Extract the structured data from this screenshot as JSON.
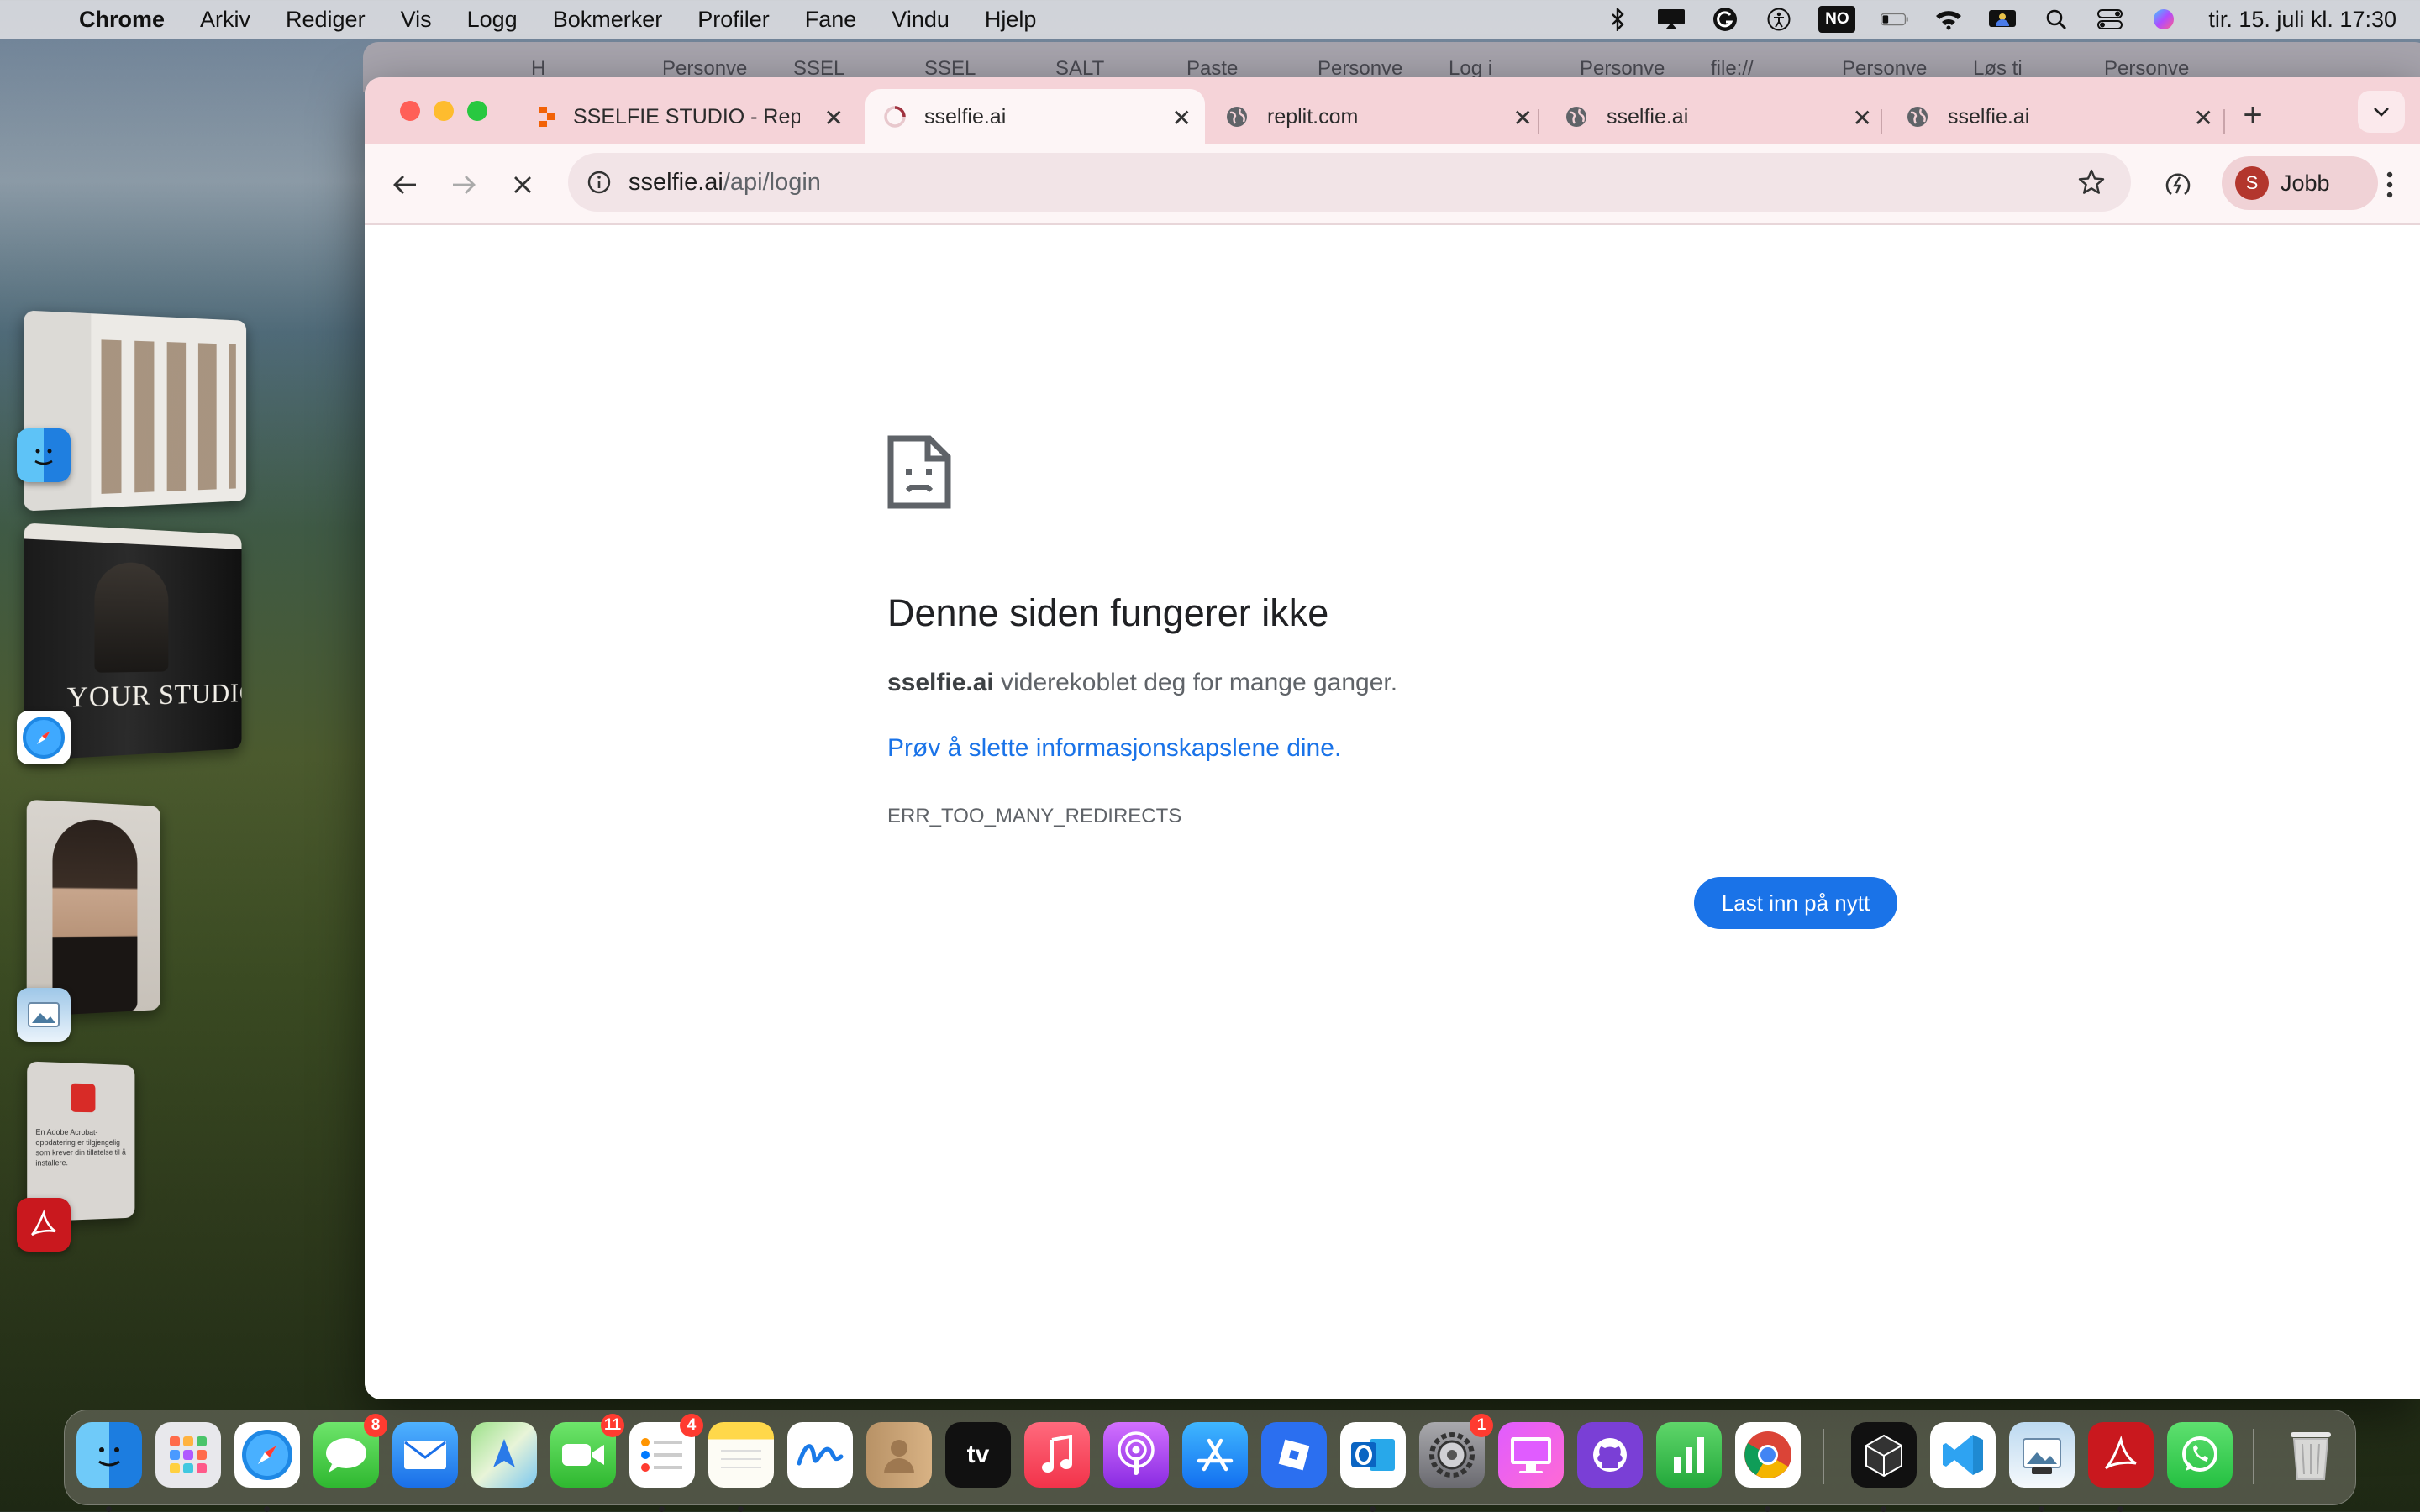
{
  "menubar": {
    "app_name": "Chrome",
    "items": [
      "Arkiv",
      "Rediger",
      "Vis",
      "Logg",
      "Bokmerker",
      "Profiler",
      "Fane",
      "Vindu",
      "Hjelp"
    ],
    "input_source": "NO",
    "datetime": "tir. 15. juli kl. 17:30"
  },
  "desktop": {
    "studio_thumb_text": "YOUR STUDIO",
    "acrobat_card_text": "En Adobe Acrobat-oppdatering er tilgjengelig som krever din tillatelse til å installere."
  },
  "back_window": {
    "tabs": [
      "H",
      "Personve",
      "SSEL",
      "SSEL",
      "SALT",
      "Paste",
      "Personve",
      "Log i",
      "Personve",
      "file://",
      "Personve",
      "Løs ti",
      "Personve"
    ]
  },
  "tabs": [
    {
      "title": "SSELFIE STUDIO - Repl",
      "icon": "replit-icon",
      "active": false
    },
    {
      "title": "sselfie.ai",
      "icon": "loading-spinner-icon",
      "active": true
    },
    {
      "title": "replit.com",
      "icon": "globe-icon",
      "active": false
    },
    {
      "title": "sselfie.ai",
      "icon": "globe-icon",
      "active": false
    },
    {
      "title": "sselfie.ai",
      "icon": "globe-icon",
      "active": false
    }
  ],
  "omnibox": {
    "domain": "sselfie.ai",
    "path": "/api/login"
  },
  "profile": {
    "initial": "S",
    "name": "Jobb"
  },
  "error_page": {
    "heading": "Denne siden fungerer ikke",
    "host": "sselfie.ai",
    "message": " viderekoblet deg for mange ganger.",
    "link": "Prøv å slette informasjonskapslene dine",
    "link_suffix": ".",
    "code": "ERR_TOO_MANY_REDIRECTS",
    "reload_label": "Last inn på nytt"
  },
  "dock": {
    "tv_label": "tv",
    "badges": {
      "messages": "8",
      "facetime": "11",
      "reminders": "4",
      "settings": "1"
    }
  },
  "colors": {
    "accent": "#1a73e8",
    "tabstrip": "#f5d3d8",
    "toolbar": "#fdf5f6"
  }
}
